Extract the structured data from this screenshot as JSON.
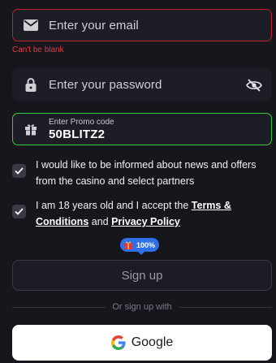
{
  "email": {
    "placeholder": "Enter your email",
    "icon": "mail-icon",
    "error": "Can't be blank",
    "border_color": "#c2202e"
  },
  "password": {
    "placeholder": "Enter your password",
    "icon": "lock-icon",
    "toggle_icon": "eye-off-icon"
  },
  "promo": {
    "label": "Enter Promo code",
    "value": "50BLITZ2",
    "icon": "gift-icon",
    "border_color": "#37c93c"
  },
  "consents": [
    {
      "text": "I would like to be informed about news and offers from the casino and select partners",
      "checked": true
    },
    {
      "text_before": "I am 18 years old and I accept the ",
      "terms_link": "Terms & Conditions",
      "text_middle": " and ",
      "privacy_link": "Privacy Policy",
      "checked": true
    }
  ],
  "bonus_badge": {
    "text": "100%",
    "icon": "gift-box-icon",
    "color": "#2f6fe8"
  },
  "signup": {
    "label": "Sign up"
  },
  "divider": {
    "text": "Or sign up with"
  },
  "google": {
    "label": "Google",
    "icon": "google-logo-icon"
  }
}
